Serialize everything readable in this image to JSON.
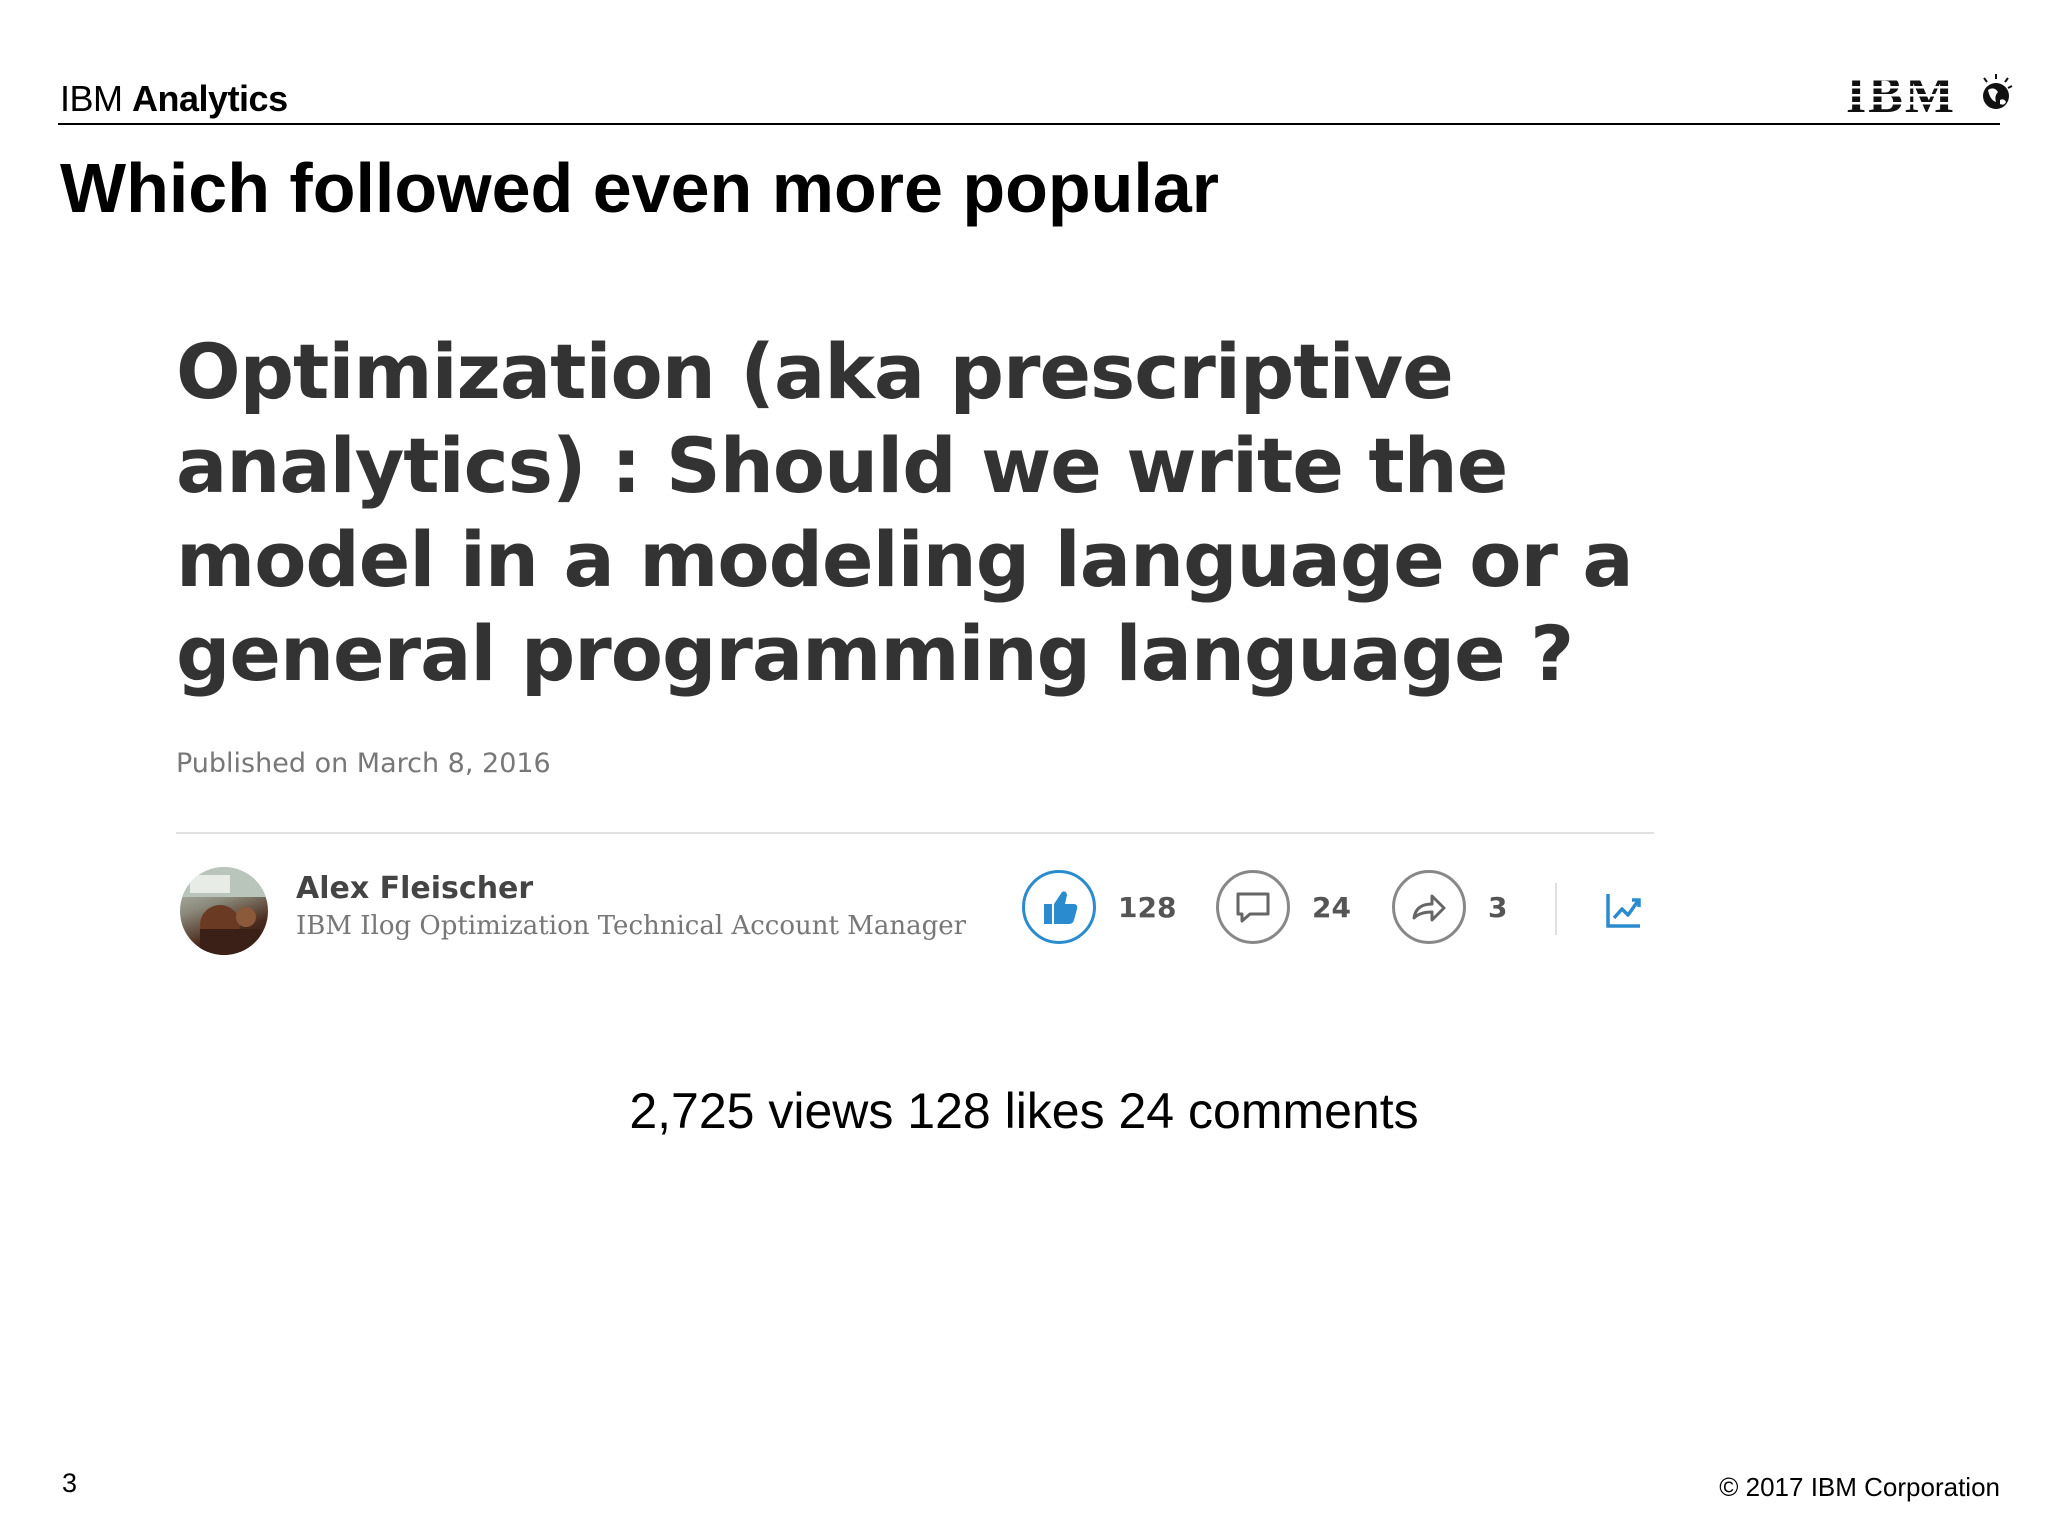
{
  "header": {
    "brand_light": "IBM",
    "brand_bold": "Analytics",
    "logo_text": "IBM"
  },
  "slide": {
    "title": "Which followed even more popular",
    "stats": "2,725 views 128 likes 24 comments",
    "page_number": "3",
    "copyright": "© 2017 IBM Corporation"
  },
  "article": {
    "title": "Optimization (aka prescriptive analytics) : Should we write the model in a modeling language or a general programming language ?",
    "published": "Published on March 8, 2016",
    "author_name": "Alex Fleischer",
    "author_role": "IBM Ilog Optimization Technical Account Manager",
    "likes": "128",
    "comments": "24",
    "shares": "3",
    "colors": {
      "like_blue": "#2a8ccf",
      "text_dark": "#333333",
      "text_muted": "#777777"
    },
    "icons": [
      "thumbs-up-icon",
      "comment-icon",
      "share-icon",
      "analytics-icon"
    ]
  }
}
